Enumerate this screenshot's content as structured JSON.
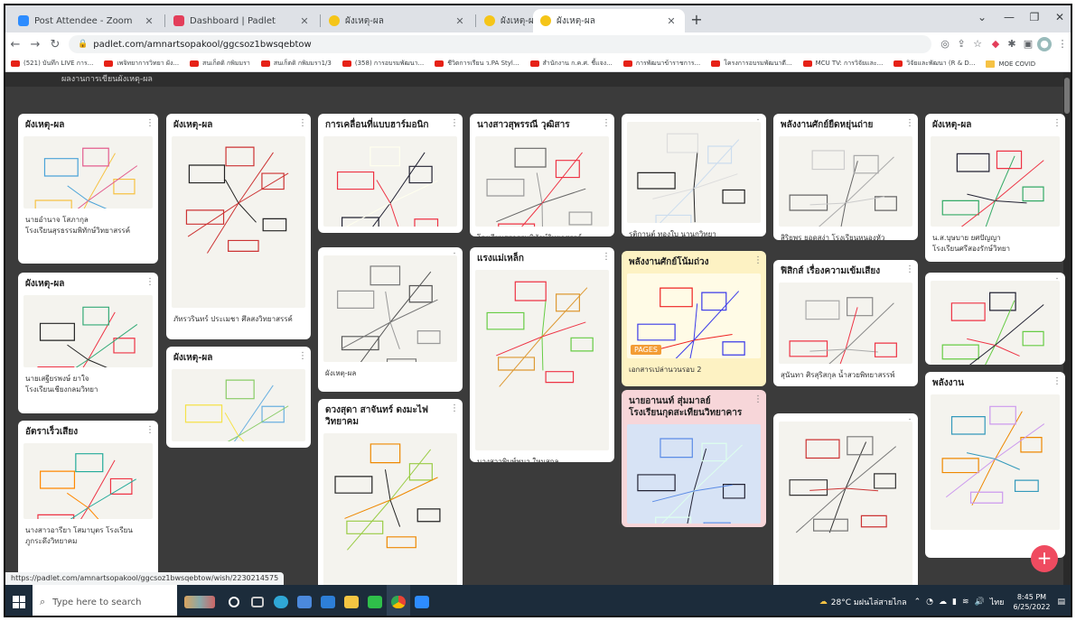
{
  "browser": {
    "tabs": [
      {
        "label": "Post Attendee - Zoom",
        "icon": "zoom-icon",
        "active": false
      },
      {
        "label": "Dashboard | Padlet",
        "icon": "padlet-icon",
        "active": false
      },
      {
        "label": "ผังเหตุ-ผล",
        "icon": "padlet-emoji-icon",
        "active": false
      },
      {
        "label": "ผังเหตุ-ผล",
        "icon": "padlet-emoji-icon",
        "active": false
      },
      {
        "label": "ผังเหตุ-ผล",
        "icon": "padlet-emoji-icon",
        "active": true
      }
    ],
    "url": "padlet.com/amnartsopakool/ggcsoz1bwsqebtow",
    "bookmarks": [
      {
        "label": "(521) บันทึก LIVE การ...",
        "type": "yt"
      },
      {
        "label": "เพจิทยาการวิทยา ผัง...",
        "type": "yt"
      },
      {
        "label": "สนเก็ตดิ กพิมมรา",
        "type": "yt"
      },
      {
        "label": "สนเก็ตดิ กพิมมรา1/3",
        "type": "yt"
      },
      {
        "label": "(358) การอบรมพัฒนา...",
        "type": "yt"
      },
      {
        "label": "ชีวิตการเรียน ว.PA Styl...",
        "type": "yt"
      },
      {
        "label": "สำนักงาน ก.ค.ศ. ชี้แจง...",
        "type": "yt"
      },
      {
        "label": "การพัฒนาข้าราชการ...",
        "type": "yt"
      },
      {
        "label": "โครงการอบรมพัฒนาตี...",
        "type": "yt"
      },
      {
        "label": "MCU TV: การวิจัยและ...",
        "type": "yt"
      },
      {
        "label": "วิจัยและพัฒนา (R & D...",
        "type": "yt"
      },
      {
        "label": "MOE COVID",
        "type": "folder"
      }
    ]
  },
  "board": {
    "header_text": "ผลงานการเขียนผังเหตุ-ผล",
    "status_url": "https://padlet.com/amnartsopakool/ggcsoz1bwsqebtow/wish/2230214575",
    "add_label": "+",
    "cards": [
      {
        "title": "ผังเหตุ-ผล",
        "body": "นายอำนาจ โสภากุล\nโรงเรียนสุรธรรมพิทักษ์วิทยาสรรค์"
      },
      {
        "title": "ผังเหตุ-ผล",
        "body": "นายเสฐียรพงษ์ ยาใจ\nโรงเรียนเชียงกลมวิทยา"
      },
      {
        "title": "อัตราเร็วเสียง",
        "body": "นางสาวอารียา โสมาบุตร โรงเรียน\nภูกระดึงวิทยาคม"
      },
      {
        "title": "ผังเหตุ-ผล",
        "body": "ภัทรวรินทร์ ประเมชา ศึลสงวิทยาสรรค์"
      },
      {
        "title": "ผังเหตุ-ผล",
        "body": ""
      },
      {
        "title": "การเคลื่อนที่แบบฮาร์มอนิก",
        "body": ""
      },
      {
        "title": "",
        "body": "ผังเหตุ-ผล"
      },
      {
        "title": "ดวงสุดา สาจันทร์ ดงมะไฟวิทยาคม",
        "body": ""
      },
      {
        "title": "นางสาวสุพรรณี วุฒิสาร",
        "body": "โรงเรียนสุรธรรมพิทักษ์วิทยาสรรค์"
      },
      {
        "title": "แรงแม่เหล็ก",
        "body": "นางสาวพิมพ์พนา ใหมสกล"
      },
      {
        "title": "",
        "body": "รติกานต์ ทองใบ นานกวิทยา"
      },
      {
        "title": "พลังงานศักย์โน้มถ่วง",
        "body": "เอกสารเปล่านวนรอบ 2",
        "badge": "PAGES"
      },
      {
        "title": "นายอานนท์ สุ่มมาลย์\nโรงเรียนกุดสะเทียนวิทยาคาร",
        "body": ""
      },
      {
        "title": "พลังงานศักย์ยืดหยุ่นถ่าย",
        "body": "สิริยพร ยอดสง่า โรงเรียนหนองหัววิทยาคาร"
      },
      {
        "title": "ฟิสิกส์ เรื่องความเข้มเสียง",
        "body": "สุนันทา ศิรสุริสกุล น้ำสวยพิทยาสรรพ์"
      },
      {
        "title": "",
        "body": ""
      },
      {
        "title": "ผังเหตุ-ผล",
        "body": "น.ส.บุษบาย ยศปัญญา\nโรงเรียนศรีสองรักษ์วิทยา"
      },
      {
        "title": "",
        "body": ""
      },
      {
        "title": "พลังงาน",
        "body": ""
      }
    ]
  },
  "taskbar": {
    "search_placeholder": "Type here to search",
    "weather": "28°C มฝนไล่สายไกล",
    "lang": "ไทย",
    "time": "8:45 PM",
    "date": "6/25/2022"
  }
}
